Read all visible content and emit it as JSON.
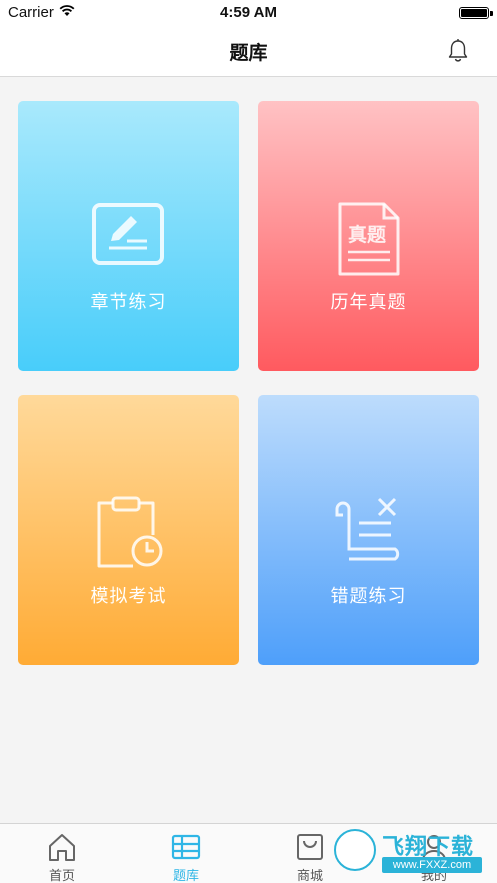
{
  "status_bar": {
    "carrier": "Carrier",
    "time": "4:59 AM",
    "battery_level": 1.0
  },
  "nav": {
    "title": "题库",
    "right_icon": "bell-icon"
  },
  "cards": [
    {
      "label": "章节练习",
      "icon": "edit-board-icon",
      "gradient": [
        "#a9e9fc",
        "#48cdfa"
      ]
    },
    {
      "label": "历年真题",
      "icon": "exam-paper-icon",
      "icon_text": "真题",
      "gradient": [
        "#ffc2c4",
        "#ff5a5f"
      ]
    },
    {
      "label": "模拟考试",
      "icon": "clipboard-clock-icon",
      "gradient": [
        "#ffd99a",
        "#ffab35"
      ]
    },
    {
      "label": "错题练习",
      "icon": "scroll-x-icon",
      "gradient": [
        "#bddcfc",
        "#4e9ffa"
      ]
    }
  ],
  "tabs": [
    {
      "label": "首页",
      "icon": "home-icon",
      "active": false
    },
    {
      "label": "题库",
      "icon": "question-bank-icon",
      "active": true
    },
    {
      "label": "商城",
      "icon": "shopping-bag-icon",
      "active": false
    },
    {
      "label": "我的",
      "icon": "profile-icon",
      "active": false
    }
  ],
  "watermark": {
    "title": "飞翔下载",
    "url": "www.FXXZ.com"
  },
  "colors": {
    "accent": "#2fb6e6",
    "watermark": "#2bb3d8"
  }
}
